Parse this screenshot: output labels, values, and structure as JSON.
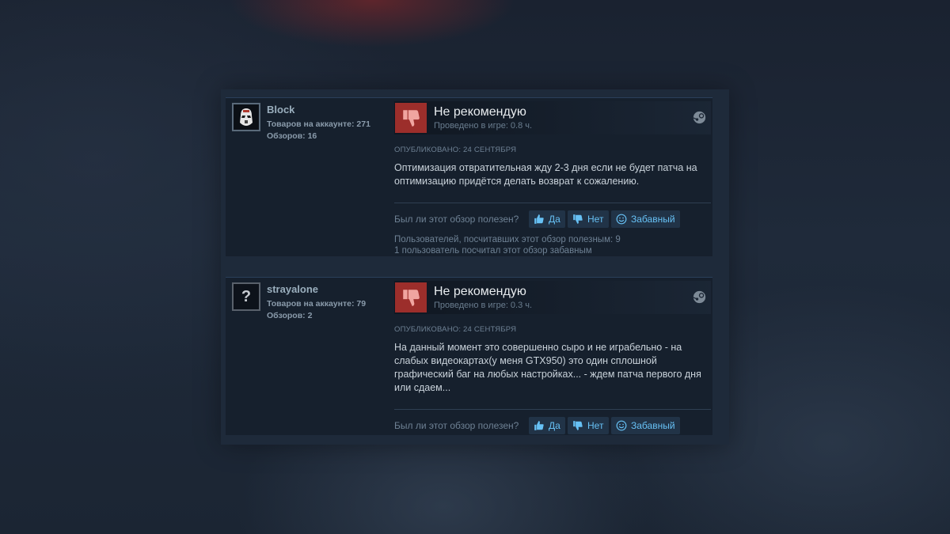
{
  "reviews": [
    {
      "author": {
        "name": "Block",
        "products": "Товаров на аккаунте: 271",
        "review_count": "Обзоров: 16",
        "avatar": "stormtrooper-helmet"
      },
      "verdict": "Не рекомендую",
      "hours": "Проведено в игре: 0.8 ч.",
      "posted": "ОПУБЛИКОВАНО: 24 СЕНТЯБРЯ",
      "text": "Оптимизация отвратительная жду 2-3 дня если не будет патча на оптимизацию придётся делать возврат к сожалению.",
      "helpful_question": "Был ли этот обзор полезен?",
      "buttons": {
        "yes": "Да",
        "no": "Нет",
        "funny": "Забавный"
      },
      "summary_helpful": "Пользователей, посчитавших этот обзор полезным: 9",
      "summary_funny": "1 пользователь посчитал этот обзор забавным"
    },
    {
      "author": {
        "name": "strayalone",
        "products": "Товаров на аккаунте: 79",
        "review_count": "Обзоров: 2",
        "avatar": "?"
      },
      "verdict": "Не рекомендую",
      "hours": "Проведено в игре: 0.3 ч.",
      "posted": "ОПУБЛИКОВАНО: 24 СЕНТЯБРЯ",
      "text": "На данный момент это совершенно сыро и не играбельно - на слабых видеокартах(у меня GTX950) это один сплошной графический баг на любых настройках... - ждем патча первого дня или сдаем...",
      "helpful_question": "Был ли этот обзор полезен?",
      "buttons": {
        "yes": "Да",
        "no": "Нет",
        "funny": "Забавный"
      }
    }
  ],
  "colors": {
    "thumb_down_bg": "#9c2e2b",
    "link_blue": "#67c1f5",
    "card_bg": "#16202d"
  }
}
